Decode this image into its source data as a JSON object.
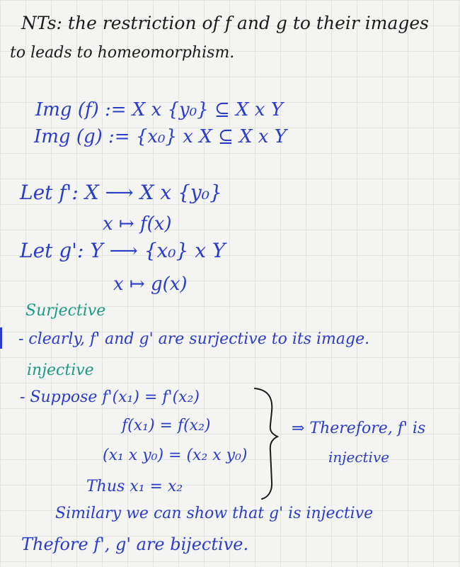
{
  "note": {
    "heading_line1": "NTs: the restriction of f and g to their images",
    "heading_line2": "to leads to homeomorphism.",
    "img_f": "Img (f) := X x {y₀} ⊆ X x Y",
    "img_g": "Img (g) := {x₀} x X  ⊆ X x Y",
    "let_f_line1": "Let  f': X ⟶ X x {y₀}",
    "let_f_line2": "x ↦ f(x)",
    "let_g_line1": "Let  g': Y ⟶ {x₀} x Y",
    "let_g_line2": "x ↦ g(x)",
    "surjective_title": "Surjective",
    "surjective_text": "- clearly, f' and g' are surjective to its image.",
    "injective_title": "injective",
    "inj_line1": "- Suppose  f'(x₁) = f'(x₂)",
    "inj_line2": "f(x₁) = f(x₂)",
    "inj_line3": "(x₁ x y₀) = (x₂ x y₀)",
    "inj_line4": "Thus  x₁ = x₂",
    "therefore_line1": "⇒ Therefore, f' is",
    "therefore_line2": "injective",
    "similarly_line": "Similary we can show that  g' is injective",
    "conclusion_line": "Thefore f', g' are bijective."
  }
}
